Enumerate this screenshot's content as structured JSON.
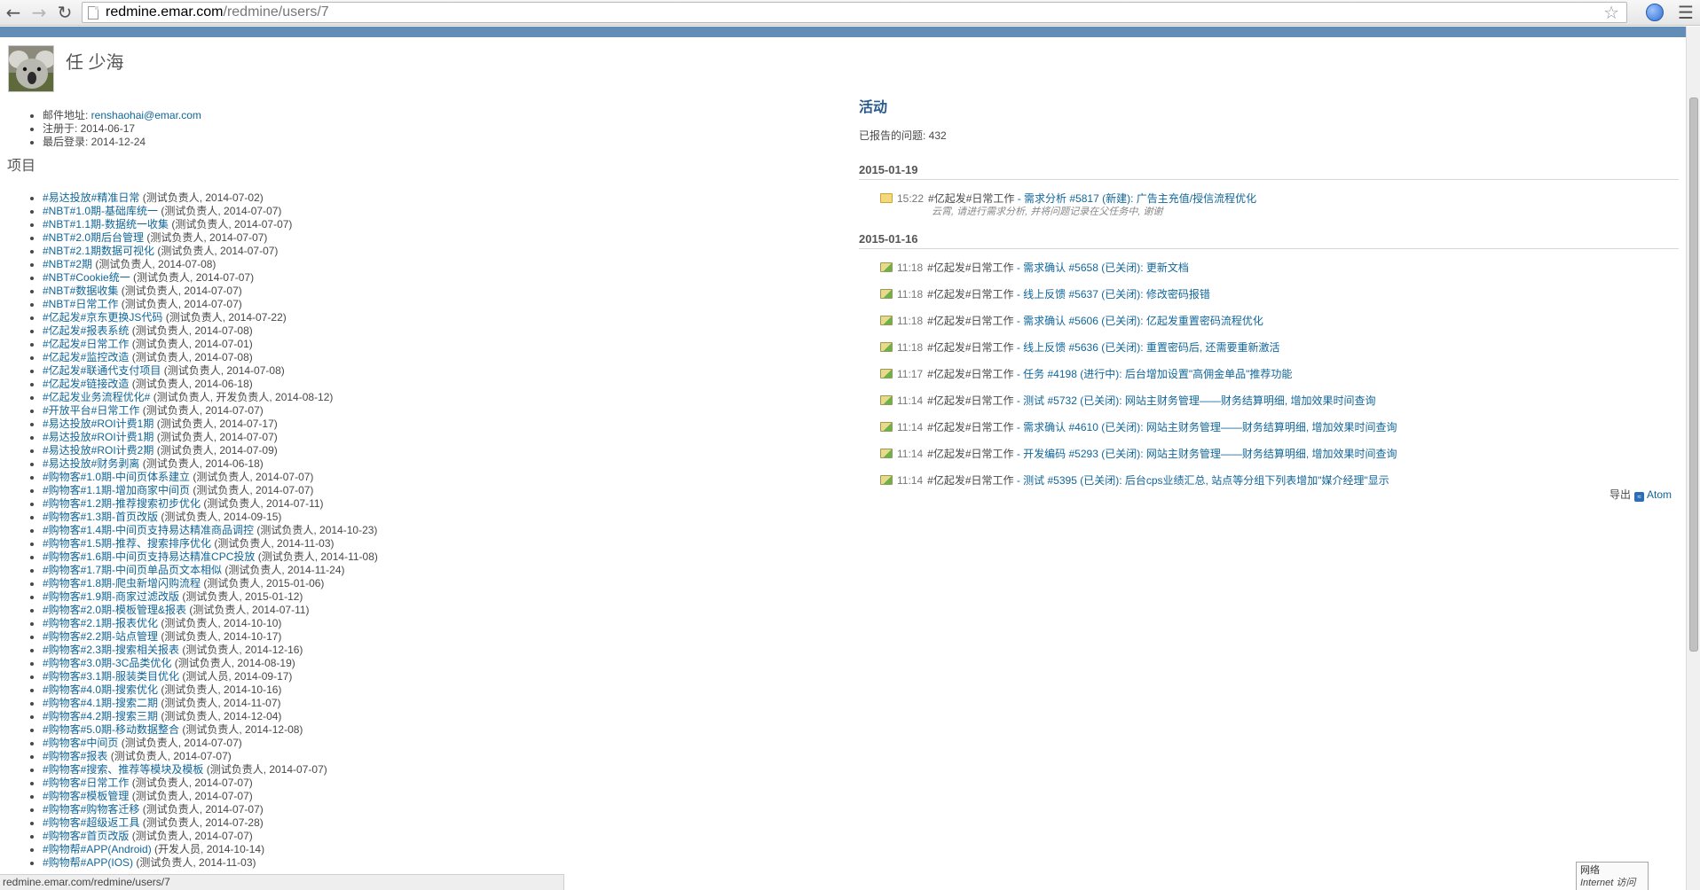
{
  "browser": {
    "url_host": "redmine.emar.com",
    "url_path": "/redmine/users/7",
    "status_url": "redmine.emar.com/redmine/users/7",
    "network_popup": {
      "title": "网络",
      "subtitle": "Internet 访问"
    }
  },
  "user": {
    "name": "任 少海",
    "email_label": "邮件地址: ",
    "email": "renshaohai@emar.com",
    "registered": "注册于: 2014-06-17",
    "last_login": "最后登录: 2014-12-24"
  },
  "projects_title": "项目",
  "projects": [
    {
      "name": "#易达投放#精准日常",
      "role": " (测试负责人, 2014-07-02)"
    },
    {
      "name": "#NBT#1.0期-基础库统一",
      "role": " (测试负责人, 2014-07-07)"
    },
    {
      "name": "#NBT#1.1期-数据统一收集",
      "role": " (测试负责人, 2014-07-07)"
    },
    {
      "name": "#NBT#2.0期后台管理",
      "role": " (测试负责人, 2014-07-07)"
    },
    {
      "name": "#NBT#2.1期数据可视化",
      "role": " (测试负责人, 2014-07-07)"
    },
    {
      "name": "#NBT#2期",
      "role": " (测试负责人, 2014-07-08)"
    },
    {
      "name": "#NBT#Cookie统一",
      "role": " (测试负责人, 2014-07-07)"
    },
    {
      "name": "#NBT#数据收集",
      "role": " (测试负责人, 2014-07-07)"
    },
    {
      "name": "#NBT#日常工作",
      "role": " (测试负责人, 2014-07-07)"
    },
    {
      "name": "#亿起发#京东更换JS代码",
      "role": " (测试负责人, 2014-07-22)"
    },
    {
      "name": "#亿起发#报表系统",
      "role": " (测试负责人, 2014-07-08)"
    },
    {
      "name": "#亿起发#日常工作",
      "role": " (测试负责人, 2014-07-01)"
    },
    {
      "name": "#亿起发#监控改造",
      "role": " (测试负责人, 2014-07-08)"
    },
    {
      "name": "#亿起发#联通代支付项目",
      "role": " (测试负责人, 2014-07-08)"
    },
    {
      "name": "#亿起发#链接改造",
      "role": " (测试负责人, 2014-06-18)"
    },
    {
      "name": "#亿起发业务流程优化#",
      "role": " (测试负责人, 开发负责人, 2014-08-12)"
    },
    {
      "name": "#开放平台#日常工作",
      "role": " (测试负责人, 2014-07-07)"
    },
    {
      "name": "#易达投放#ROI计费1期",
      "role": " (测试负责人, 2014-07-17)"
    },
    {
      "name": "#易达投放#ROI计费1期",
      "role": " (测试负责人, 2014-07-07)"
    },
    {
      "name": "#易达投放#ROI计费2期",
      "role": " (测试负责人, 2014-07-09)"
    },
    {
      "name": "#易达投放#财务剥离",
      "role": " (测试负责人, 2014-06-18)"
    },
    {
      "name": "#购物客#1.0期-中间页体系建立",
      "role": " (测试负责人, 2014-07-07)"
    },
    {
      "name": "#购物客#1.1期-增加商家中间页",
      "role": " (测试负责人, 2014-07-07)"
    },
    {
      "name": "#购物客#1.2期-推荐搜索初步优化",
      "role": " (测试负责人, 2014-07-11)"
    },
    {
      "name": "#购物客#1.3期-首页改版",
      "role": " (测试负责人, 2014-09-15)"
    },
    {
      "name": "#购物客#1.4期-中间页支持易达精准商品调控",
      "role": " (测试负责人, 2014-10-23)"
    },
    {
      "name": "#购物客#1.5期-推荐、搜索排序优化",
      "role": " (测试负责人, 2014-11-03)"
    },
    {
      "name": "#购物客#1.6期-中间页支持易达精准CPC投放",
      "role": " (测试负责人, 2014-11-08)"
    },
    {
      "name": "#购物客#1.7期-中间页单品页文本相似",
      "role": " (测试负责人, 2014-11-24)"
    },
    {
      "name": "#购物客#1.8期-爬虫新增闪购流程",
      "role": " (测试负责人, 2015-01-06)"
    },
    {
      "name": "#购物客#1.9期-商家过滤改版",
      "role": " (测试负责人, 2015-01-12)"
    },
    {
      "name": "#购物客#2.0期-模板管理&报表",
      "role": " (测试负责人, 2014-07-11)"
    },
    {
      "name": "#购物客#2.1期-报表优化",
      "role": " (测试负责人, 2014-10-10)"
    },
    {
      "name": "#购物客#2.2期-站点管理",
      "role": " (测试负责人, 2014-10-17)"
    },
    {
      "name": "#购物客#2.3期-搜索相关报表",
      "role": " (测试负责人, 2014-12-16)"
    },
    {
      "name": "#购物客#3.0期-3C品类优化",
      "role": " (测试负责人, 2014-08-19)"
    },
    {
      "name": "#购物客#3.1期-服装类目优化",
      "role": " (测试人员, 2014-09-17)"
    },
    {
      "name": "#购物客#4.0期-搜索优化",
      "role": " (测试负责人, 2014-10-16)"
    },
    {
      "name": "#购物客#4.1期-搜索二期",
      "role": " (测试负责人, 2014-11-07)"
    },
    {
      "name": "#购物客#4.2期-搜索三期",
      "role": " (测试负责人, 2014-12-04)"
    },
    {
      "name": "#购物客#5.0期-移动数据整合",
      "role": " (测试负责人, 2014-12-08)"
    },
    {
      "name": "#购物客#中间页",
      "role": " (测试负责人, 2014-07-07)"
    },
    {
      "name": "#购物客#报表",
      "role": " (测试负责人, 2014-07-07)"
    },
    {
      "name": "#购物客#搜索、推荐等模块及模板",
      "role": " (测试负责人, 2014-07-07)"
    },
    {
      "name": "#购物客#日常工作",
      "role": " (测试负责人, 2014-07-07)"
    },
    {
      "name": "#购物客#模板管理",
      "role": " (测试负责人, 2014-07-07)"
    },
    {
      "name": "#购物客#购物客迁移",
      "role": " (测试负责人, 2014-07-07)"
    },
    {
      "name": "#购物客#超级返工具",
      "role": " (测试负责人, 2014-07-28)"
    },
    {
      "name": "#购物客#首页改版",
      "role": " (测试负责人, 2014-07-07)"
    },
    {
      "name": "#购物帮#APP(Android)",
      "role": " (开发人员, 2014-10-14)"
    },
    {
      "name": "#购物帮#APP(IOS)",
      "role": " (测试负责人, 2014-11-03)"
    }
  ],
  "activity": {
    "title": "活动",
    "reported_issues": "已报告的问题: 432",
    "groups": [
      {
        "date": "2015-01-19",
        "entries": [
          {
            "time": "15:22",
            "project": "#亿起发#日常工作",
            "link": " - 需求分析 #5817 (新建): 广告主充值/授信流程优化",
            "icon": "note",
            "description": "云霄, 请进行需求分析, 并将问题记录在父任务中, 谢谢"
          }
        ]
      },
      {
        "date": "2015-01-16",
        "entries": [
          {
            "time": "11:18",
            "project": "#亿起发#日常工作",
            "link": " - 需求确认 #5658 (已关闭): 更新文档",
            "icon": "edit"
          },
          {
            "time": "11:18",
            "project": "#亿起发#日常工作",
            "link": " - 线上反馈 #5637 (已关闭): 修改密码报错",
            "icon": "edit"
          },
          {
            "time": "11:18",
            "project": "#亿起发#日常工作",
            "link": " - 需求确认 #5606 (已关闭): 亿起发重置密码流程优化",
            "icon": "edit"
          },
          {
            "time": "11:18",
            "project": "#亿起发#日常工作",
            "link": " - 线上反馈 #5636 (已关闭): 重置密码后, 还需要重新激活",
            "icon": "edit"
          },
          {
            "time": "11:17",
            "project": "#亿起发#日常工作",
            "link": " - 任务 #4198 (进行中): 后台增加设置\"高佣金单品\"推荐功能",
            "icon": "edit"
          },
          {
            "time": "11:14",
            "project": "#亿起发#日常工作",
            "link": " - 测试 #5732 (已关闭): 网站主财务管理——财务结算明细, 增加效果时间查询",
            "icon": "edit"
          },
          {
            "time": "11:14",
            "project": "#亿起发#日常工作",
            "link": " - 需求确认 #4610 (已关闭): 网站主财务管理——财务结算明细, 增加效果时间查询",
            "icon": "edit"
          },
          {
            "time": "11:14",
            "project": "#亿起发#日常工作",
            "link": " - 开发编码 #5293 (已关闭): 网站主财务管理——财务结算明细, 增加效果时间查询",
            "icon": "edit"
          },
          {
            "time": "11:14",
            "project": "#亿起发#日常工作",
            "link": " - 测试 #5395 (已关闭): 后台cps业绩汇总, 站点等分组下列表增加\"媒介经理\"显示",
            "icon": "edit"
          }
        ]
      }
    ],
    "export_label": "导出",
    "atom_label": "Atom"
  }
}
